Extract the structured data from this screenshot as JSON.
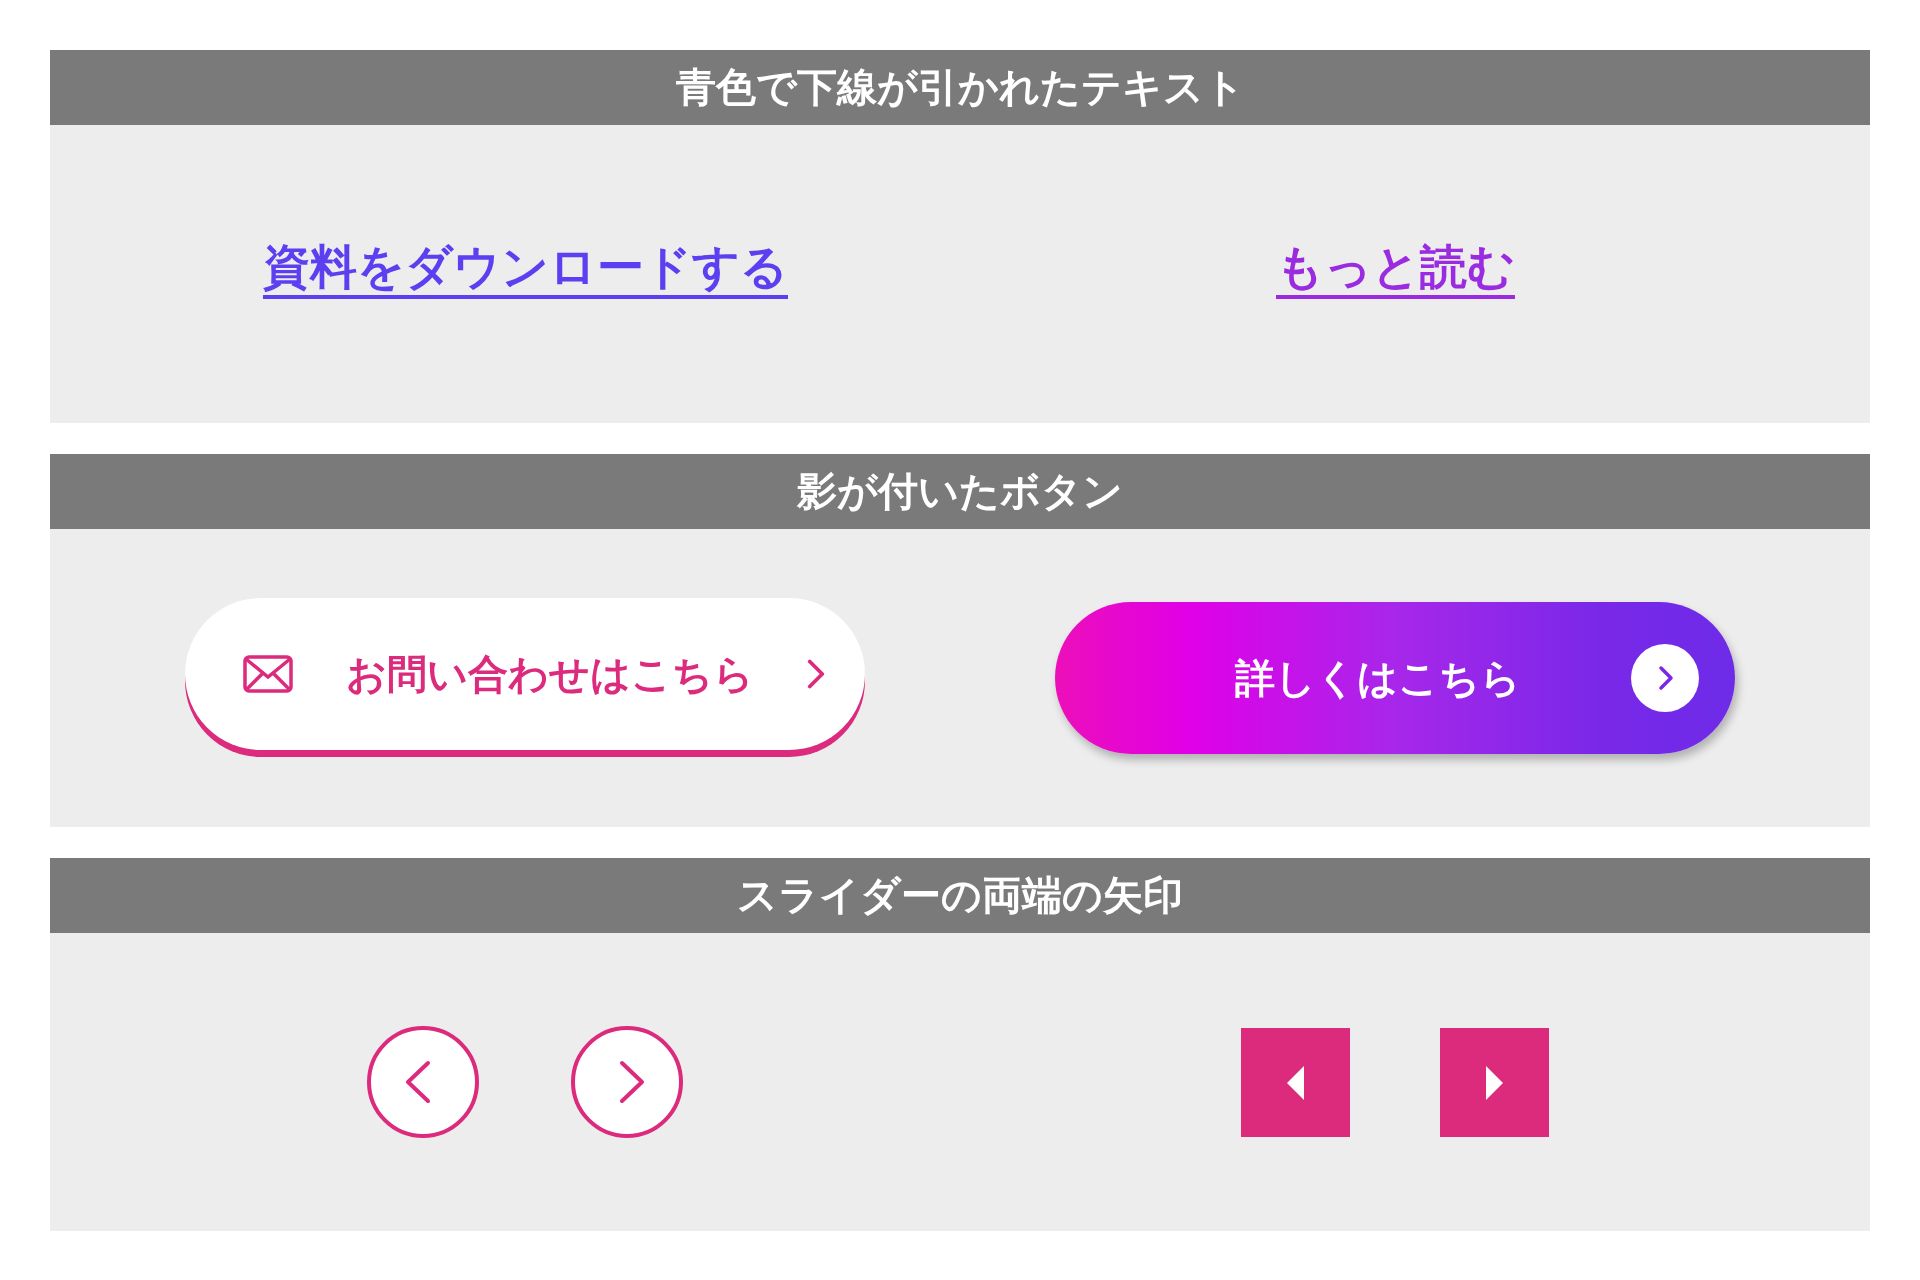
{
  "sections": [
    {
      "kind": "links",
      "title": "青色で下線が引かれたテキスト",
      "items": [
        {
          "label": "資料をダウンロードする",
          "color": "#5b3ff0"
        },
        {
          "label": "もっと読む",
          "color": "#9b2be0"
        }
      ]
    },
    {
      "kind": "buttons",
      "title": "影が付いたボタン",
      "items": [
        {
          "kind": "outline",
          "label": "お問い合わせはこちら"
        },
        {
          "kind": "gradient",
          "label": "詳しくはこちら"
        }
      ]
    },
    {
      "kind": "arrows",
      "title": "スライダーの両端の矢印",
      "items": [
        {
          "kind": "circle",
          "points_left": true
        },
        {
          "kind": "circle",
          "points_left": false
        },
        {
          "kind": "square",
          "points_left": true
        },
        {
          "kind": "square",
          "points_left": false
        }
      ]
    }
  ]
}
